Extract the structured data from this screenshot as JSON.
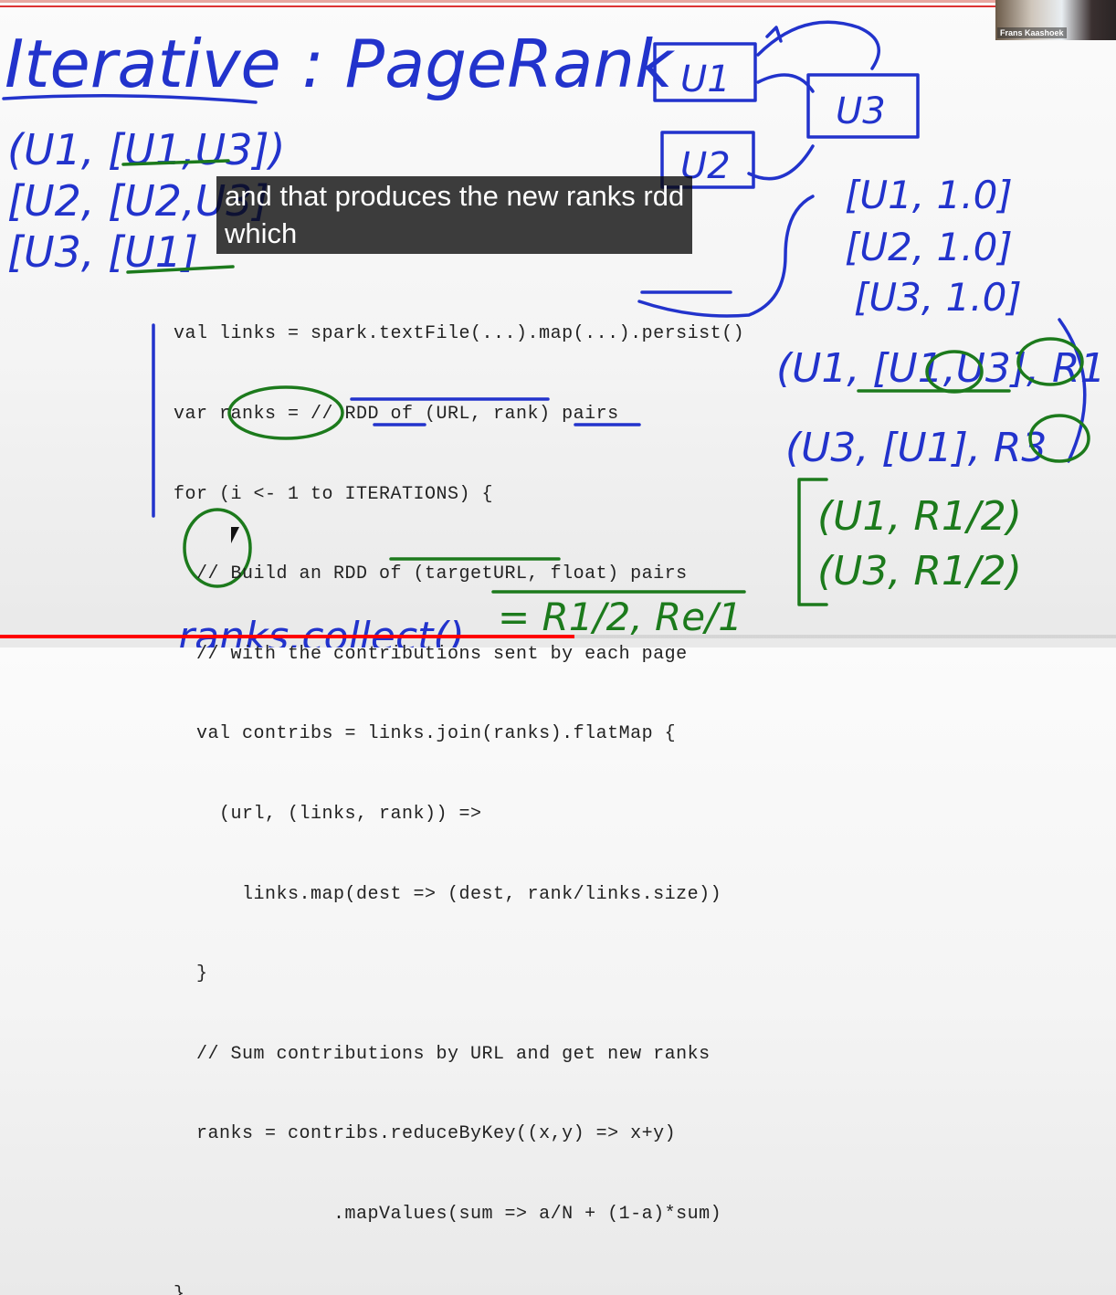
{
  "video": {
    "speaker_name": "Frans Kaashoek",
    "subtitle_lines": [
      "and that produces the new ranks rdd",
      "which"
    ],
    "progress_percent": 51.5,
    "progress_color": "#ff0000"
  },
  "slide": {
    "title_handwritten": "Iterative : PageRank",
    "code_lines": [
      "val links = spark.textFile(...).map(...).persist()",
      "var ranks = // RDD of (URL, rank) pairs",
      "for (i <- 1 to ITERATIONS) {",
      "  // Build an RDD of (targetURL, float) pairs",
      "  // with the contributions sent by each page",
      "  val contribs = links.join(ranks).flatMap {",
      "    (url, (links, rank)) =>",
      "      links.map(dest => (dest, rank/links.size))",
      "  }",
      "  // Sum contributions by URL and get new ranks",
      "  ranks = contribs.reduceByKey((x,y) => x+y)",
      "              .mapValues(sum => a/N + (1-a)*sum)",
      "}"
    ],
    "annotations": {
      "links_left": [
        "(U1, [U1,U3])",
        "[U2, [U2,U3]",
        "[U3, [U1]"
      ],
      "graph_nodes": [
        "U1",
        "U3",
        "U2"
      ],
      "ranks_right": [
        "[U1, 1.0]",
        "[U2, 1.0]",
        "[U3, 1.0]"
      ],
      "joined": [
        "(U1, [U1,U3], R1",
        "(U3, [U1], R3"
      ],
      "contribs": [
        "(U1, R1/2)",
        "(U3, R1/2)"
      ],
      "sum_result": "= R1/2, Re/1",
      "collect": "ranks.collect()"
    },
    "ink_colors": {
      "blue": "#2233cc",
      "green": "#1c7a1c"
    }
  }
}
